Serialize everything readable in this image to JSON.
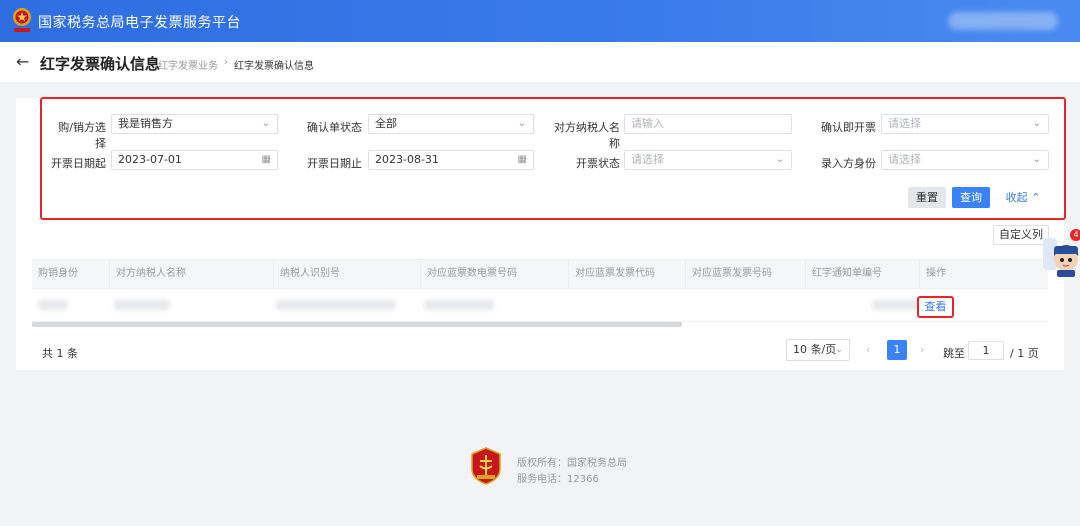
{
  "header": {
    "app_title": "国家税务总局电子发票服务平台"
  },
  "titlebar": {
    "back_icon": "arrow-left-icon",
    "page_title": "红字发票确认信息",
    "breadcrumb": [
      "红字发票业务",
      "›",
      "红字发票确认信息"
    ]
  },
  "filters": {
    "buyer_seller_label": "购/销方选择",
    "buyer_seller_value": "我是销售方",
    "confirm_status_label": "确认单状态",
    "confirm_status_value": "全部",
    "counterparty_name_label": "对方纳税人名称",
    "counterparty_name_placeholder": "请输入",
    "confirm_issue_label": "确认即开票",
    "confirm_issue_placeholder": "请选择",
    "date_start_label": "开票日期起",
    "date_start_value": "2023-07-01",
    "date_end_label": "开票日期止",
    "date_end_value": "2023-08-31",
    "issue_status_label": "开票状态",
    "issue_status_placeholder": "请选择",
    "entry_role_label": "录入方身份",
    "entry_role_placeholder": "请选择"
  },
  "actions": {
    "reset": "重置",
    "query": "查询",
    "collapse": "收起 ⌃",
    "custom_columns": "自定义列"
  },
  "table": {
    "columns": [
      "购销身份",
      "对方纳税人名称",
      "纳税人识别号",
      "对应蓝票数电票号码",
      "对应蓝票发票代码",
      "对应蓝票发票号码",
      "红字通知单编号",
      "操作"
    ],
    "row_action": "查看"
  },
  "pagination": {
    "total": "共 1 条",
    "page_size": "10 条/页",
    "current_page": "1",
    "jump_label": "跳至",
    "jump_value": "1",
    "total_pages": "/ 1 页"
  },
  "footer": {
    "copyright": "版权所有：国家税务总局",
    "phone": "服务电话：12366"
  },
  "float_badge": "4",
  "colors": {
    "header_blue": "#3a7bea",
    "primary": "#3b82f6",
    "highlight_red": "#e5252a",
    "link_blue": "#3b7be8"
  }
}
